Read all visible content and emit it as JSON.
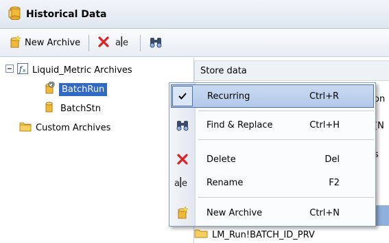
{
  "window": {
    "title": "Historical Data"
  },
  "toolbar": {
    "new_archive_label": "New Archive"
  },
  "tree": {
    "root_label": "Liquid_Metric Archives",
    "items": [
      {
        "label": "BatchRun"
      },
      {
        "label": "BatchStn"
      }
    ],
    "custom_label": "Custom Archives"
  },
  "right_pane": {
    "header": "Store data",
    "partial_texts": [
      "on",
      "(N",
      "s"
    ],
    "bottom_item": "LM_Run!BATCH_ID_PRV"
  },
  "context_menu": {
    "items": [
      {
        "label": "Recurring",
        "shortcut": "Ctrl+R",
        "icon": "check-icon"
      },
      {
        "label": "Find & Replace",
        "shortcut": "Ctrl+H",
        "icon": "binoculars-icon"
      },
      {
        "label": "Delete",
        "shortcut": "Del",
        "icon": "delete-x-icon"
      },
      {
        "label": "Rename",
        "shortcut": "F2",
        "icon": "rename-icon"
      },
      {
        "label": "New Archive",
        "shortcut": "Ctrl+N",
        "icon": "new-archive-icon"
      }
    ]
  },
  "colors": {
    "selection": "#316ac5",
    "menu_hover": "#b3c9ea",
    "delete_red": "#e02020"
  }
}
